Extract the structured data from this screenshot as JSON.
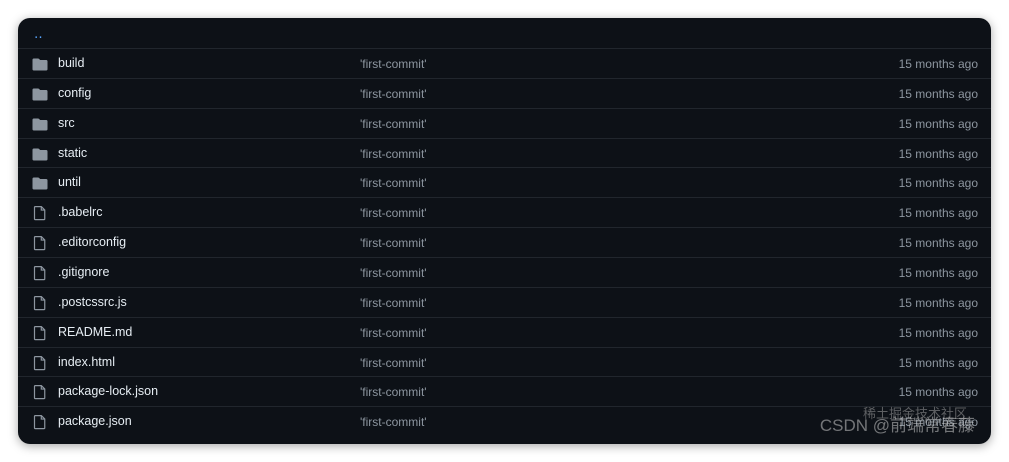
{
  "parent_link": "‥",
  "rows": [
    {
      "type": "folder",
      "name": "build",
      "commit": "'first-commit'",
      "age": "15 months ago"
    },
    {
      "type": "folder",
      "name": "config",
      "commit": "'first-commit'",
      "age": "15 months ago"
    },
    {
      "type": "folder",
      "name": "src",
      "commit": "'first-commit'",
      "age": "15 months ago"
    },
    {
      "type": "folder",
      "name": "static",
      "commit": "'first-commit'",
      "age": "15 months ago"
    },
    {
      "type": "folder",
      "name": "until",
      "commit": "'first-commit'",
      "age": "15 months ago"
    },
    {
      "type": "file",
      "name": ".babelrc",
      "commit": "'first-commit'",
      "age": "15 months ago"
    },
    {
      "type": "file",
      "name": ".editorconfig",
      "commit": "'first-commit'",
      "age": "15 months ago"
    },
    {
      "type": "file",
      "name": ".gitignore",
      "commit": "'first-commit'",
      "age": "15 months ago"
    },
    {
      "type": "file",
      "name": ".postcssrc.js",
      "commit": "'first-commit'",
      "age": "15 months ago"
    },
    {
      "type": "file",
      "name": "README.md",
      "commit": "'first-commit'",
      "age": "15 months ago"
    },
    {
      "type": "file",
      "name": "index.html",
      "commit": "'first-commit'",
      "age": "15 months ago"
    },
    {
      "type": "file",
      "name": "package-lock.json",
      "commit": "'first-commit'",
      "age": "15 months ago"
    },
    {
      "type": "file",
      "name": "package.json",
      "commit": "'first-commit'",
      "age": "15 months ago"
    }
  ],
  "watermark": {
    "top": "稀土掘金技术社区",
    "bottom": "CSDN @前端常春藤"
  },
  "colors": {
    "background": "#0d1117",
    "row_border": "#21262d",
    "text": "#e6edf3",
    "muted": "#8d96a0",
    "icon": "#8d96a0",
    "link": "#58a6ff"
  },
  "icons": {
    "folder": "folder-icon",
    "file": "file-icon"
  }
}
